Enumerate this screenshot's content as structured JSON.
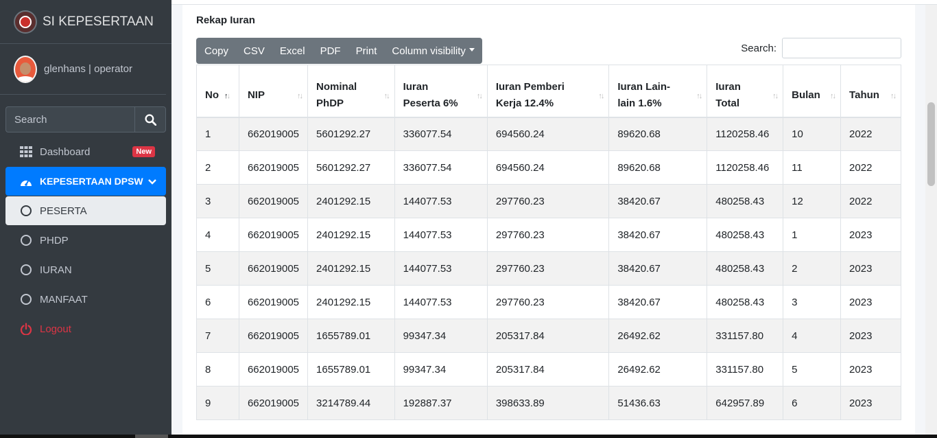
{
  "brand": {
    "title": "SI KEPESERTAAN"
  },
  "user": {
    "label": "glenhans | operator"
  },
  "sidebar_search": {
    "placeholder": "Search"
  },
  "nav": {
    "dashboard": {
      "label": "Dashboard",
      "badge": "New"
    },
    "kepesertaan": {
      "label": "KEPESERTAAN DPSW"
    },
    "peserta": {
      "label": "PESERTA"
    },
    "phdp": {
      "label": "PHDP"
    },
    "iuran": {
      "label": "IURAN"
    },
    "manfaat": {
      "label": "MANFAAT"
    },
    "logout": {
      "label": "Logout"
    }
  },
  "card": {
    "title": "Rekap Iuran"
  },
  "toolbar": {
    "copy": "Copy",
    "csv": "CSV",
    "excel": "Excel",
    "pdf": "PDF",
    "print": "Print",
    "column_visibility": "Column visibility"
  },
  "table_search": {
    "label": "Search:"
  },
  "table": {
    "headers": [
      {
        "line1": "No",
        "line2": ""
      },
      {
        "line1": "NIP",
        "line2": ""
      },
      {
        "line1": "Nominal",
        "line2": "PhDP"
      },
      {
        "line1": "Iuran",
        "line2": "Peserta 6%"
      },
      {
        "line1": "Iuran Pemberi",
        "line2": "Kerja 12.4%"
      },
      {
        "line1": "Iuran Lain-",
        "line2": "lain 1.6%"
      },
      {
        "line1": "Iuran",
        "line2": "Total"
      },
      {
        "line1": "Bulan",
        "line2": ""
      },
      {
        "line1": "Tahun",
        "line2": ""
      }
    ],
    "rows": [
      [
        "1",
        "662019005",
        "5601292.27",
        "336077.54",
        "694560.24",
        "89620.68",
        "1120258.46",
        "10",
        "2022"
      ],
      [
        "2",
        "662019005",
        "5601292.27",
        "336077.54",
        "694560.24",
        "89620.68",
        "1120258.46",
        "11",
        "2022"
      ],
      [
        "3",
        "662019005",
        "2401292.15",
        "144077.53",
        "297760.23",
        "38420.67",
        "480258.43",
        "12",
        "2022"
      ],
      [
        "4",
        "662019005",
        "2401292.15",
        "144077.53",
        "297760.23",
        "38420.67",
        "480258.43",
        "1",
        "2023"
      ],
      [
        "5",
        "662019005",
        "2401292.15",
        "144077.53",
        "297760.23",
        "38420.67",
        "480258.43",
        "2",
        "2023"
      ],
      [
        "6",
        "662019005",
        "2401292.15",
        "144077.53",
        "297760.23",
        "38420.67",
        "480258.43",
        "3",
        "2023"
      ],
      [
        "7",
        "662019005",
        "1655789.01",
        "99347.34",
        "205317.84",
        "26492.62",
        "331157.80",
        "4",
        "2023"
      ],
      [
        "8",
        "662019005",
        "1655789.01",
        "99347.34",
        "205317.84",
        "26492.62",
        "331157.80",
        "5",
        "2023"
      ],
      [
        "9",
        "662019005",
        "3214789.44",
        "192887.37",
        "398633.89",
        "51436.63",
        "642957.89",
        "6",
        "2023"
      ]
    ]
  },
  "colors": {
    "sidebar_bg": "#343a40",
    "active": "#007bff",
    "danger": "#dc3545",
    "button_bg": "#6c757d"
  }
}
